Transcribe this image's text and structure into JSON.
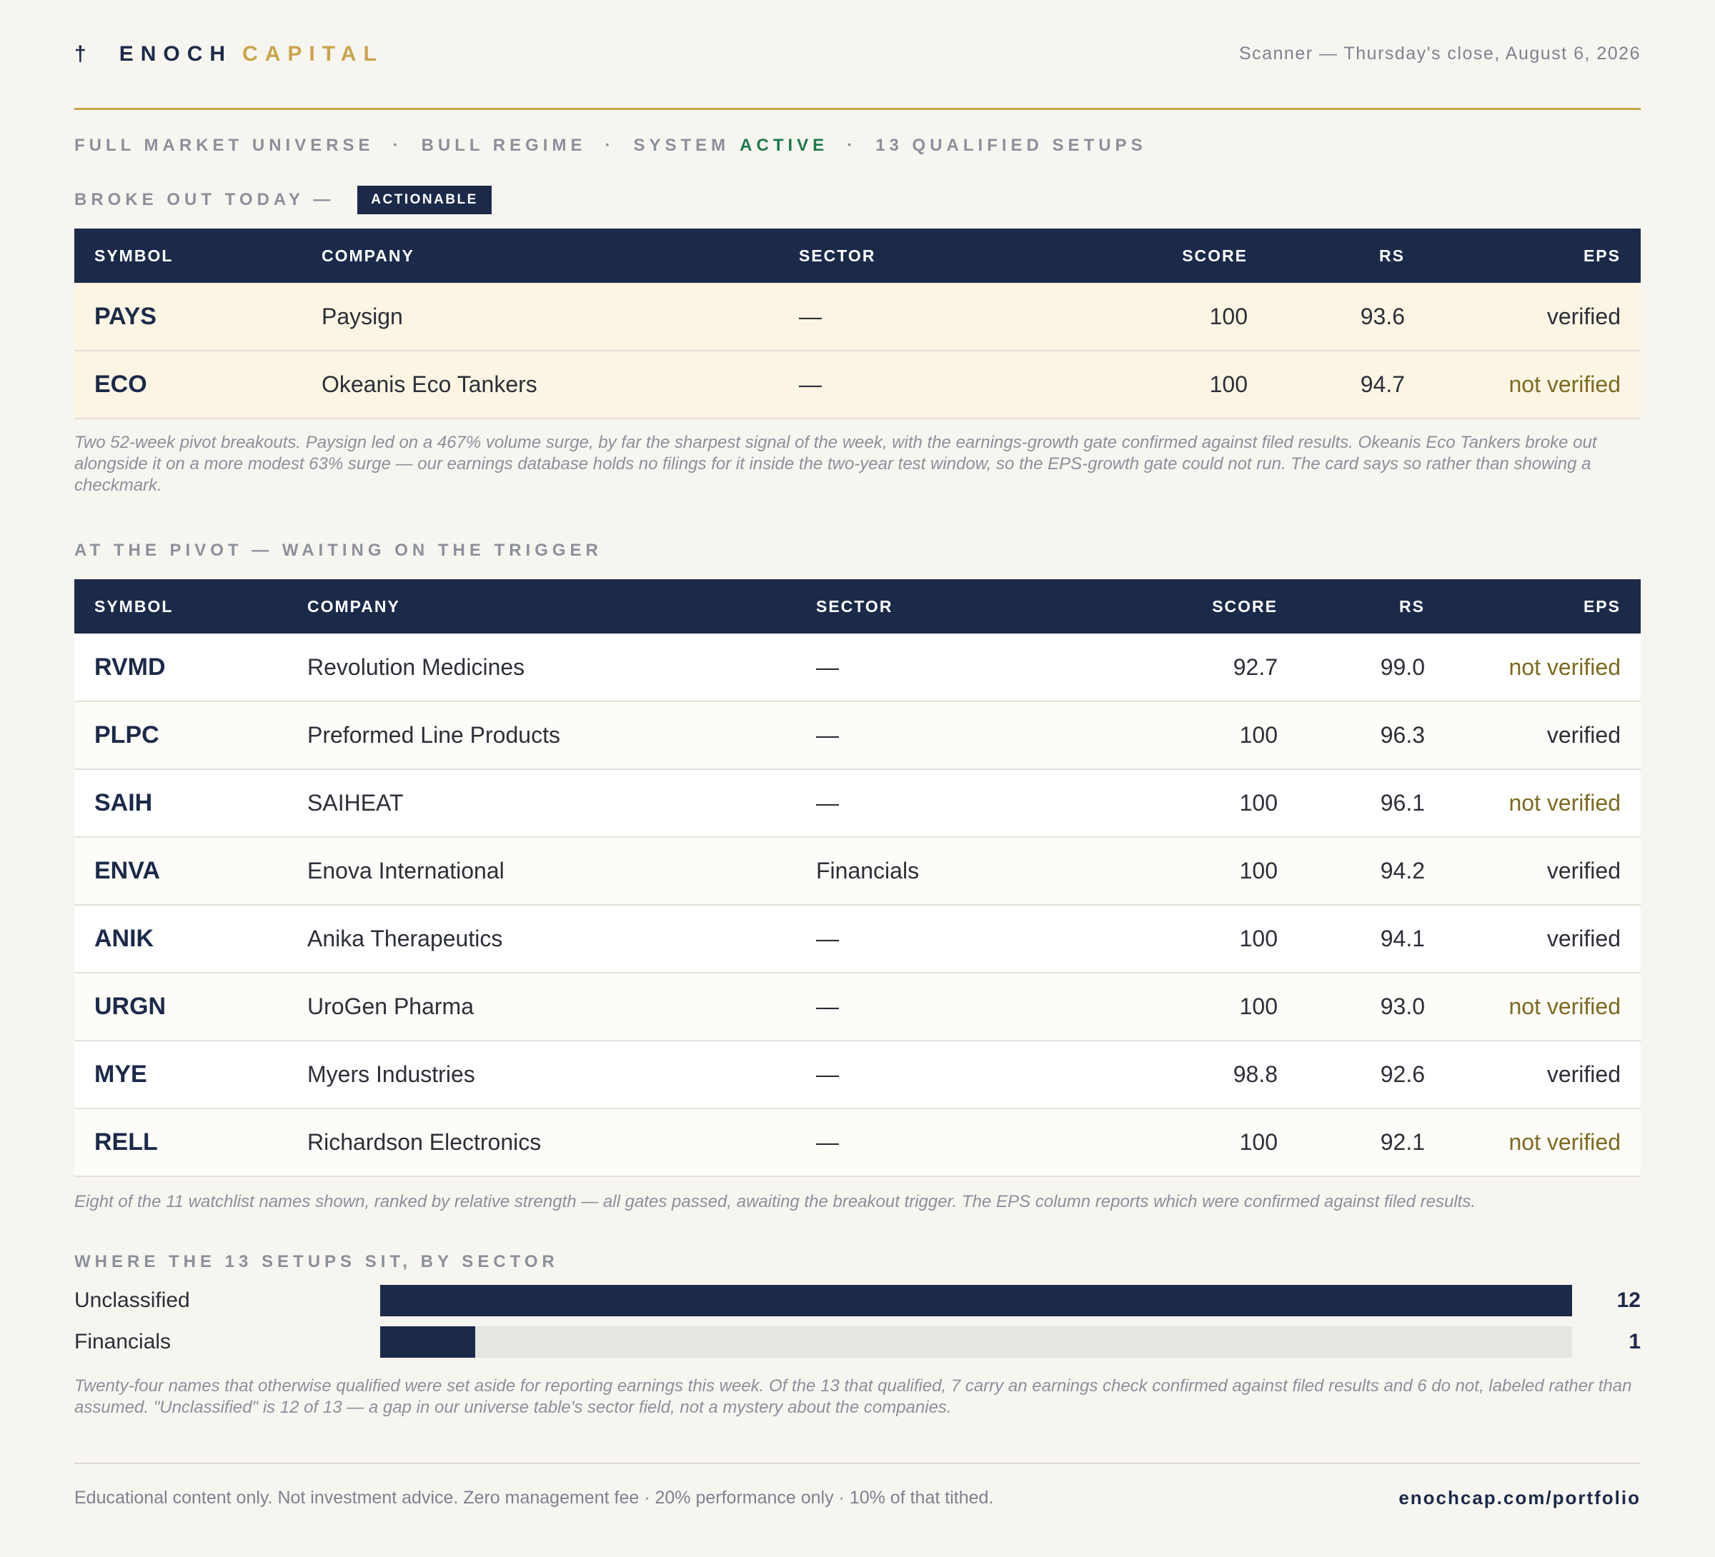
{
  "header": {
    "cross": "†",
    "brand_word1": "ENOCH",
    "brand_word2": "CAPITAL",
    "dateline": "Scanner — Thursday's close, August 6, 2026"
  },
  "status": {
    "universe": "FULL MARKET UNIVERSE",
    "regime": "BULL REGIME",
    "system_label": "SYSTEM",
    "system_state": "ACTIVE",
    "setups": "13 QUALIFIED SETUPS",
    "separator": "·",
    "active_color": "#1a7a48"
  },
  "broke_out": {
    "label": "BROKE OUT TODAY —",
    "badge": "ACTIONABLE",
    "columns": [
      "SYMBOL",
      "COMPANY",
      "SECTOR",
      "SCORE",
      "RS",
      "EPS"
    ],
    "rows": [
      {
        "symbol": "PAYS",
        "company": "Paysign",
        "sector": "—",
        "score": "100",
        "rs": "93.6",
        "eps": "verified"
      },
      {
        "symbol": "ECO",
        "company": "Okeanis Eco Tankers",
        "sector": "—",
        "score": "100",
        "rs": "94.7",
        "eps": "not verified"
      }
    ],
    "note": "Two 52-week pivot breakouts. Paysign led on a 467% volume surge, by far the sharpest signal of the week, with the earnings-growth gate confirmed against filed results. Okeanis Eco Tankers broke out alongside it on a more modest 63% surge — our earnings database holds no filings for it inside the two-year test window, so the EPS-growth gate could not run. The card says so rather than showing a checkmark."
  },
  "pivot": {
    "label": "AT THE PIVOT — WAITING ON THE TRIGGER",
    "columns": [
      "SYMBOL",
      "COMPANY",
      "SECTOR",
      "SCORE",
      "RS",
      "EPS"
    ],
    "rows": [
      {
        "symbol": "RVMD",
        "company": "Revolution Medicines",
        "sector": "—",
        "score": "92.7",
        "rs": "99.0",
        "eps": "not verified"
      },
      {
        "symbol": "PLPC",
        "company": "Preformed Line Products",
        "sector": "—",
        "score": "100",
        "rs": "96.3",
        "eps": "verified"
      },
      {
        "symbol": "SAIH",
        "company": "SAIHEAT",
        "sector": "—",
        "score": "100",
        "rs": "96.1",
        "eps": "not verified"
      },
      {
        "symbol": "ENVA",
        "company": "Enova International",
        "sector": "Financials",
        "score": "100",
        "rs": "94.2",
        "eps": "verified"
      },
      {
        "symbol": "ANIK",
        "company": "Anika Therapeutics",
        "sector": "—",
        "score": "100",
        "rs": "94.1",
        "eps": "verified"
      },
      {
        "symbol": "URGN",
        "company": "UroGen Pharma",
        "sector": "—",
        "score": "100",
        "rs": "93.0",
        "eps": "not verified"
      },
      {
        "symbol": "MYE",
        "company": "Myers Industries",
        "sector": "—",
        "score": "98.8",
        "rs": "92.6",
        "eps": "verified"
      },
      {
        "symbol": "RELL",
        "company": "Richardson Electronics",
        "sector": "—",
        "score": "100",
        "rs": "92.1",
        "eps": "not verified"
      }
    ],
    "note": "Eight of the 11 watchlist names shown, ranked by relative strength — all gates passed, awaiting the breakout trigger. The EPS column reports which were confirmed against filed results."
  },
  "sectors": {
    "label": "WHERE THE 13 SETUPS SIT, BY SECTOR",
    "total": 13,
    "rows": [
      {
        "name": "Unclassified",
        "count": "12",
        "fraction": 1.0
      },
      {
        "name": "Financials",
        "count": "1",
        "fraction": 0.08
      }
    ],
    "note": "Twenty-four names that otherwise qualified were set aside for reporting earnings this week. Of the 13 that qualified, 7 carry an earnings check confirmed against filed results and 6 do not, labeled rather than assumed. \"Unclassified\" is 12 of 13 — a gap in our universe table's sector field, not a mystery about the companies."
  },
  "footer": {
    "disclaimer": "Educational content only. Not investment advice. Zero management fee · 20% performance only · 10% of that tithed.",
    "url": "enochcap.com/portfolio"
  },
  "colors": {
    "navy": "#1c2a4a",
    "gold": "#c9a54b",
    "not_verified": "#7d6a1f"
  }
}
